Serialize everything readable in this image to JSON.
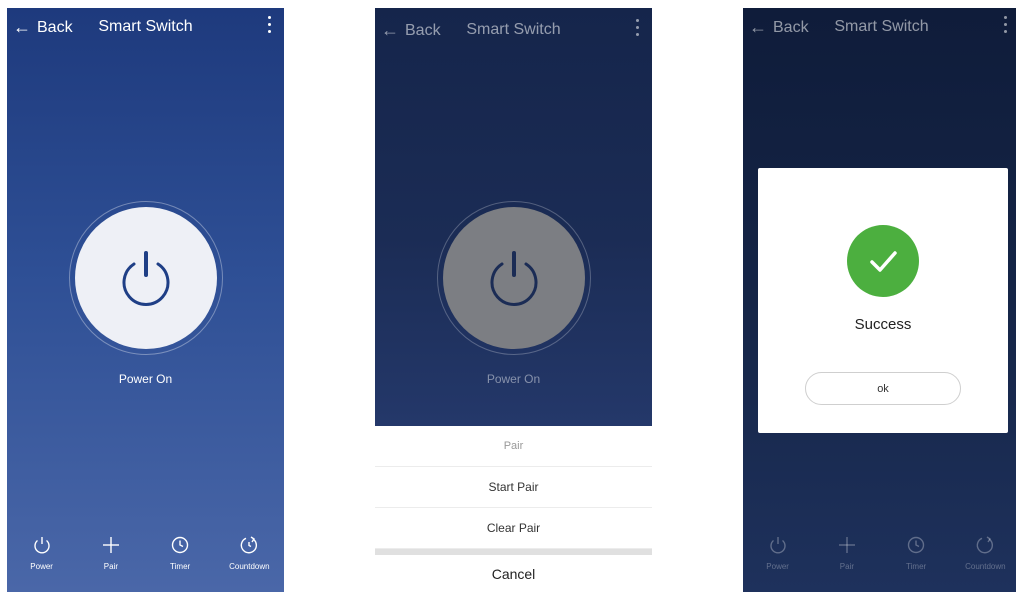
{
  "screen1": {
    "back_label": "Back",
    "title": "Smart Switch",
    "power_status": "Power On",
    "nav": [
      "Power",
      "Pair",
      "Timer",
      "Countdown"
    ]
  },
  "screen2": {
    "back_label": "Back",
    "title": "Smart Switch",
    "power_status": "Power On",
    "sheet_title": "Pair",
    "start_pair": "Start Pair",
    "clear_pair": "Clear Pair",
    "cancel": "Cancel"
  },
  "screen3": {
    "back_label": "Back",
    "title": "Smart Switch",
    "dialog_message": "Success",
    "ok_label": "ok",
    "nav": [
      "Power",
      "Pair",
      "Timer",
      "Countdown"
    ]
  },
  "colors": {
    "screen1_bg_top": "#1e3a7d",
    "screen1_bg_bottom": "#4a67a8",
    "power_icon": "#1f3f86",
    "success_green": "#4caf3f"
  },
  "icons": {
    "back": "arrow-left-icon",
    "more": "more-vertical-icon",
    "power": "power-icon",
    "pair": "plus-icon",
    "timer": "clock-icon",
    "countdown": "countdown-icon",
    "success": "checkmark-icon"
  }
}
